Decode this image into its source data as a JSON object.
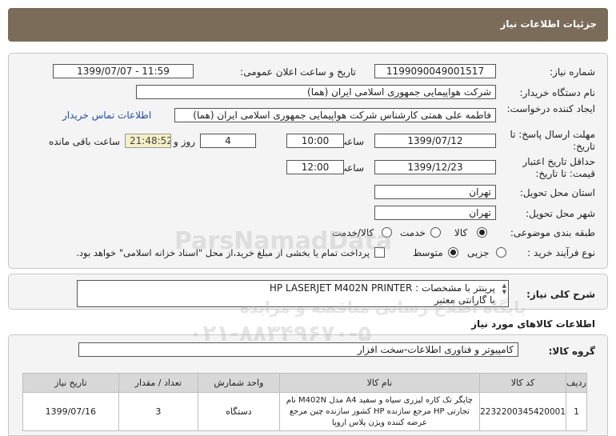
{
  "header": {
    "title": "جزئیات اطلاعات نیاز"
  },
  "fields": {
    "need_number_label": "شماره نیاز:",
    "need_number": "1199090049001517",
    "announce_label": "تاریخ و ساعت اعلان عمومی:",
    "announce_value": "1399/07/07 - 11:59",
    "buyer_label": "نام دستگاه خریدار:",
    "buyer_value": "شرکت هواپیمایی جمهوری اسلامی ایران (هما)",
    "creator_label": "ایجاد کننده درخواست:",
    "creator_value": "فاطمه علی همتی کارشناس شرکت هواپیمایی جمهوری اسلامی ایران (هما)",
    "contact_link": "اطلاعات تماس خریدار",
    "send_deadline_label": "مهلت ارسال پاسخ: تا تاریخ:",
    "send_date": "1399/07/12",
    "time_label": "ساعت",
    "send_time": "10:00",
    "days_value": "4",
    "days_label": "روز و",
    "remaining_time": "21:48:52",
    "remaining_label": "ساعت باقی مانده",
    "validity_label": "حداقل تاریخ اعتبار قیمت: تا تاریخ:",
    "validity_date": "1399/12/23",
    "validity_time": "12:00",
    "province_label": "استان محل تحویل:",
    "province_value": "تهران",
    "city_label": "شهر محل تحویل:",
    "city_value": "تهران",
    "category_label": "طبقه بندی موضوعی:",
    "category_options": [
      "کالا",
      "خدمت",
      "کالا/خدمت"
    ],
    "process_label": "نوع فرآیند خرید :",
    "process_options": [
      "جزیی",
      "متوسط"
    ],
    "payment_note": "پرداخت تمام یا بخشی از مبلغ خرید،از محل \"اسناد خزانه اسلامی\" خواهد بود."
  },
  "description": {
    "label": "شرح کلی نیاز:",
    "line1": "پرینتر با مشخصات : HP LASERJET M402N PRINTER",
    "line2": "با گارانتی معتبر"
  },
  "goods": {
    "section_title": "اطلاعات کالاهای مورد نیاز",
    "group_label": "گروه کالا:",
    "group_value": "کامپیوتر و فناوری اطلاعات-سخت افزار",
    "columns": [
      "ردیف",
      "کد کالا",
      "نام کالا",
      "واحد شمارش",
      "تعداد / مقدار",
      "تاریخ نیاز"
    ],
    "rows": [
      {
        "index": "1",
        "code": "2232200345420001",
        "name": "چاپگر تک کاره لیزری سیاه و سفید A4 مدل M402N نام تجارتی HP مرجع سازنده HP کشور سازنده چین مرجع عرضه کننده ویژن پلاس اروپا",
        "unit": "دستگاه",
        "qty": "3",
        "date": "1399/07/16"
      }
    ]
  },
  "watermark": {
    "brand": "ParsNamadData",
    "line1": "پایگاه اطلاع رسانی مناقصه و مزایده",
    "phone": "۰۲۱-۸۸۳۴۹۶۷۰-۵"
  }
}
